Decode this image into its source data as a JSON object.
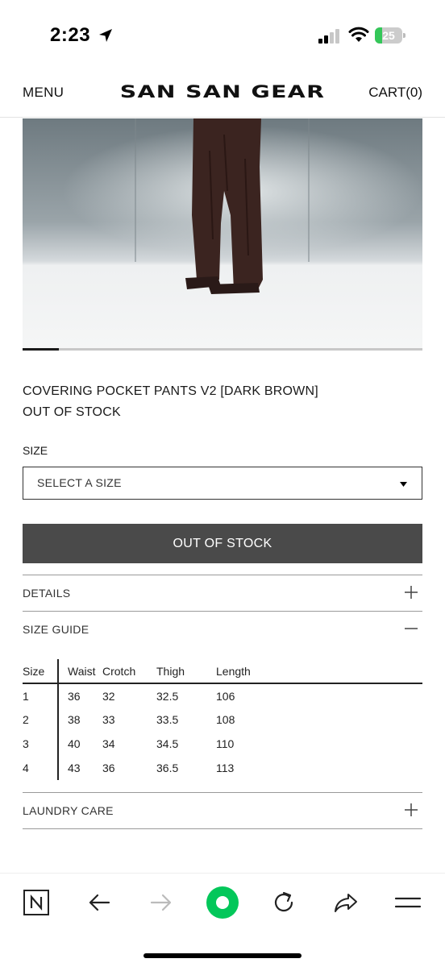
{
  "status_bar": {
    "time": "2:23",
    "battery_percent": 25,
    "battery_label": "25",
    "battery_color": "#34c759"
  },
  "header": {
    "menu_label": "MENU",
    "logo": "SAN SAN GEAR",
    "cart_label": "CART(0)"
  },
  "product": {
    "name": "COVERING POCKET PANTS V2 [DARK BROWN]",
    "stock_status": "OUT OF STOCK",
    "image_icon": "product-photo-pants",
    "carousel_progress": 0.09
  },
  "size_selector": {
    "label": "SIZE",
    "selected": "SELECT A SIZE"
  },
  "buy_button": {
    "label": "OUT OF STOCK"
  },
  "accordions": [
    {
      "label": "DETAILS",
      "icon": "plus-icon",
      "expanded": false
    },
    {
      "label": "SIZE GUIDE",
      "icon": "minus-icon",
      "expanded": true
    },
    {
      "label": "LAUNDRY CARE",
      "icon": "plus-icon",
      "expanded": false
    }
  ],
  "size_guide": {
    "headers": [
      "Size",
      "Waist",
      "Crotch",
      "Thigh",
      "Length"
    ],
    "rows": [
      [
        "1",
        "36",
        "32",
        "32.5",
        "106"
      ],
      [
        "2",
        "38",
        "33",
        "33.5",
        "108"
      ],
      [
        "3",
        "40",
        "34",
        "34.5",
        "110"
      ],
      [
        "4",
        "43",
        "36",
        "36.5",
        "113"
      ]
    ]
  },
  "browser_toolbar": {
    "buttons": [
      "naver-n-icon",
      "back-arrow-icon",
      "forward-arrow-icon",
      "green-circle-home-icon",
      "reload-icon",
      "share-icon",
      "menu-lines-icon"
    ],
    "accent_color": "#03c75a"
  }
}
